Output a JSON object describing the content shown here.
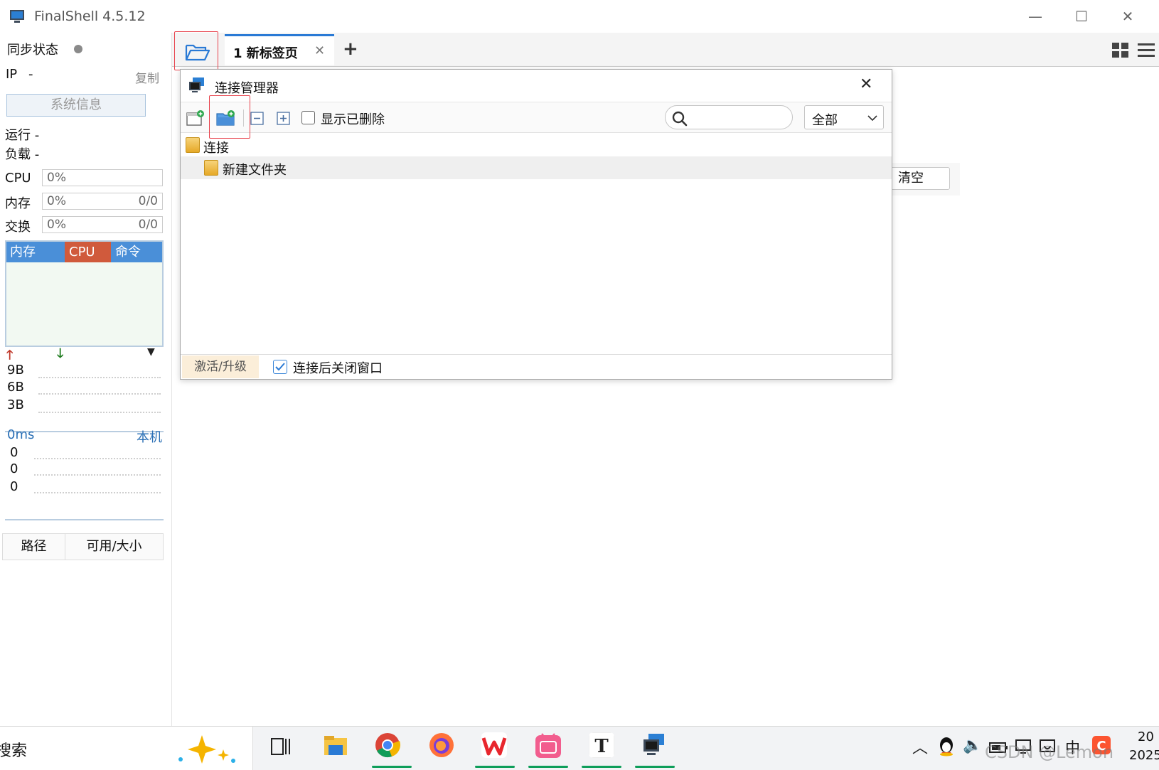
{
  "app": {
    "title": "FinalShell 4.5.12"
  },
  "sidebar": {
    "sync_label": "同步状态",
    "ip_label": "IP",
    "ip_value": "-",
    "copy_label": "复制",
    "sysinfo_button": "系统信息",
    "run_label": "运行 -",
    "load_label": "负载 -",
    "cpu_label": "CPU",
    "cpu_value": "0%",
    "mem_label": "内存",
    "mem_value": "0%",
    "mem_ratio": "0/0",
    "swap_label": "交换",
    "swap_value": "0%",
    "swap_ratio": "0/0",
    "proc_tabs": [
      "内存",
      "CPU",
      "命令"
    ],
    "net_ticks": [
      "9B",
      "6B",
      "3B"
    ],
    "ping_label": "0ms",
    "ping_host": "本机",
    "ping_ticks": [
      "0",
      "0",
      "0"
    ],
    "disk_cols": [
      "路径",
      "可用/大小"
    ]
  },
  "tabs": {
    "items": [
      {
        "label": "1 新标签页"
      }
    ],
    "add": "+"
  },
  "main": {
    "clear_button": "清空"
  },
  "dialog": {
    "title": "连接管理器",
    "show_deleted": "显示已删除",
    "search_placeholder": "",
    "filter_value": "全部",
    "tree": [
      {
        "label": "连接"
      },
      {
        "label": "新建文件夹"
      }
    ],
    "activate": "激活/升级",
    "close_after": "连接后关闭窗口"
  },
  "taskbar": {
    "search": "搜索",
    "clock_time": "20",
    "clock_date": "2025",
    "ime": "中",
    "watermark": "CSDN @Lemon"
  },
  "colors": {
    "highlight": "#e8434d",
    "cpu_tab": "#d05a3c",
    "mem_tab": "#4a8fd8",
    "accent": "#2a7ad5"
  }
}
